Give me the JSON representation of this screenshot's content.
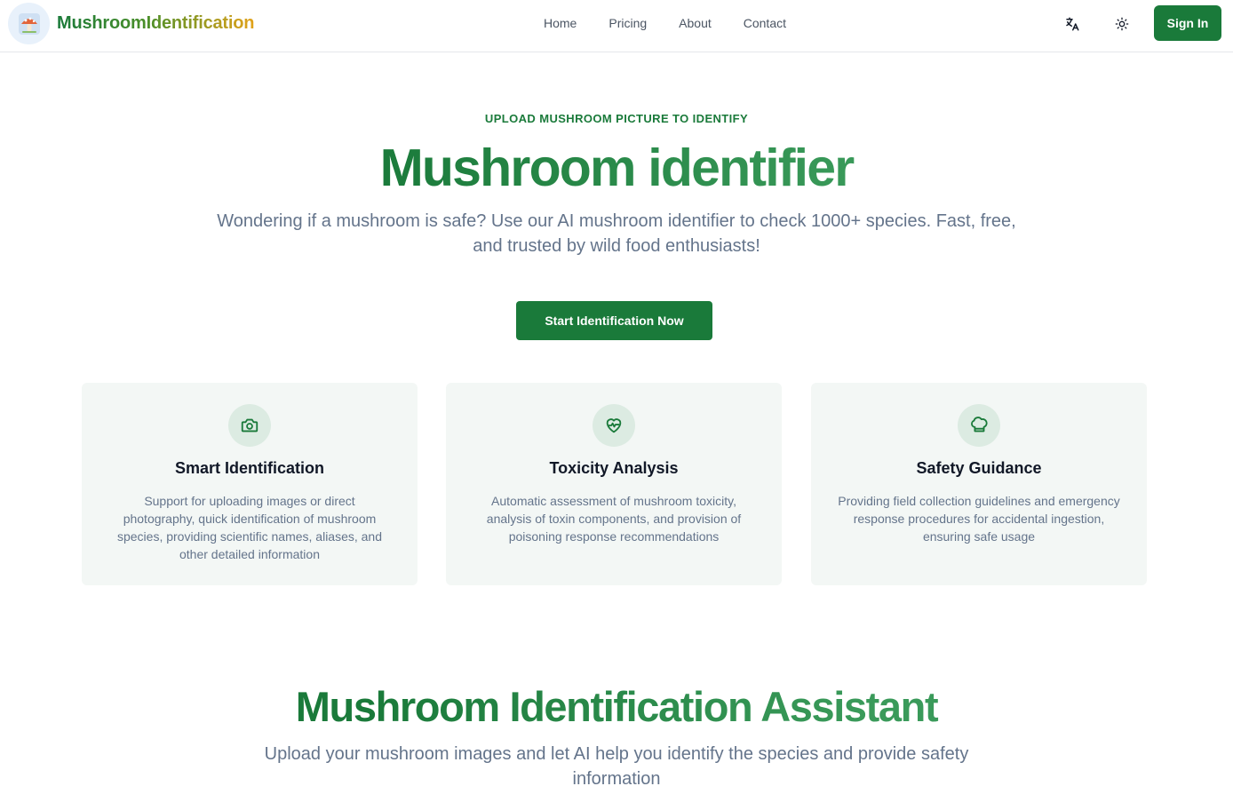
{
  "header": {
    "brand_name": "MushroomIdentification",
    "nav": [
      "Home",
      "Pricing",
      "About",
      "Contact"
    ],
    "sign_in_label": "Sign In",
    "icons": {
      "language": "translate-icon",
      "theme": "sun-icon"
    }
  },
  "hero": {
    "eyebrow": "UPLOAD MUSHROOM PICTURE TO IDENTIFY",
    "title": "Mushroom identifier",
    "subtitle": "Wondering if a mushroom is safe? Use our AI mushroom identifier to check 1000+ species. Fast, free, and trusted by wild food enthusiasts!",
    "cta_label": "Start Identification Now"
  },
  "features": [
    {
      "icon": "camera-icon",
      "title": "Smart Identification",
      "description": "Support for uploading images or direct photography, quick identification of mushroom species, providing scientific names, aliases, and other detailed information"
    },
    {
      "icon": "heart-pulse-icon",
      "title": "Toxicity Analysis",
      "description": "Automatic assessment of mushroom toxicity, analysis of toxin components, and provision of poisoning response recommendations"
    },
    {
      "icon": "chef-hat-icon",
      "title": "Safety Guidance",
      "description": "Providing field collection guidelines and emergency response procedures for accidental ingestion, ensuring safe usage"
    }
  ],
  "assistant": {
    "title": "Mushroom Identification Assistant",
    "subtitle": "Upload your mushroom images and let AI help you identify the species and provide safety information"
  },
  "colors": {
    "brand_green": "#1a7a3a",
    "card_bg": "#f3f7f5",
    "icon_circle": "#dcebe2",
    "muted_text": "#64748b"
  }
}
